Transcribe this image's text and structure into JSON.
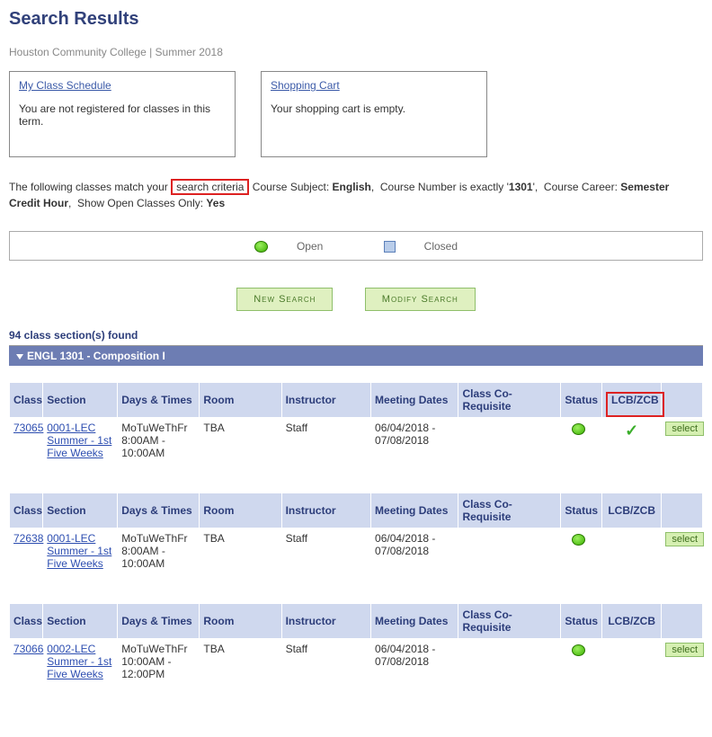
{
  "title": "Search Results",
  "subhead": "Houston Community College | Summer 2018",
  "panel1": {
    "title": "My Class Schedule",
    "body": "You are not registered for classes in this term."
  },
  "panel2": {
    "title": "Shopping Cart",
    "body": "Your shopping cart is empty."
  },
  "criteria": {
    "prefix": "The following classes match your",
    "boxed": "search criteria",
    "subject_label": "Course Subject:",
    "subject_value": "English",
    "number_label": "Course Number is exactly '",
    "number_value": "1301",
    "number_suffix": "',",
    "career_label": "Course Career:",
    "career_value": "Semester Credit Hour",
    "open_label": "Show Open Classes Only:",
    "open_value": "Yes"
  },
  "legend": {
    "open": "Open",
    "closed": "Closed"
  },
  "buttons": {
    "new_search": "New Search",
    "modify_search": "Modify Search"
  },
  "found": "94 class section(s) found",
  "course": "ENGL 1301 - Composition I",
  "headers": {
    "class": "Class",
    "section": "Section",
    "days": "Days & Times",
    "room": "Room",
    "instructor": "Instructor",
    "meeting": "Meeting Dates",
    "coreq": "Class Co-Requisite",
    "status": "Status",
    "lcb": "LCB/ZCB"
  },
  "select_label": "select",
  "rows": [
    {
      "class": "73065",
      "section_code": "0001-LEC",
      "section_term": "Summer - 1st Five Weeks",
      "days": "MoTuWeThFr 8:00AM - 10:00AM",
      "room": "TBA",
      "instructor": "Staff",
      "meeting": "06/04/2018 - 07/08/2018",
      "lcb_check": true
    },
    {
      "class": "72638",
      "section_code": "0001-LEC",
      "section_term": "Summer - 1st Five Weeks",
      "days": "MoTuWeThFr 8:00AM - 10:00AM",
      "room": "TBA",
      "instructor": "Staff",
      "meeting": "06/04/2018 - 07/08/2018",
      "lcb_check": false
    },
    {
      "class": "73066",
      "section_code": "0002-LEC",
      "section_term": "Summer - 1st Five Weeks",
      "days": "MoTuWeThFr 10:00AM - 12:00PM",
      "room": "TBA",
      "instructor": "Staff",
      "meeting": "06/04/2018 - 07/08/2018",
      "lcb_check": false
    }
  ]
}
